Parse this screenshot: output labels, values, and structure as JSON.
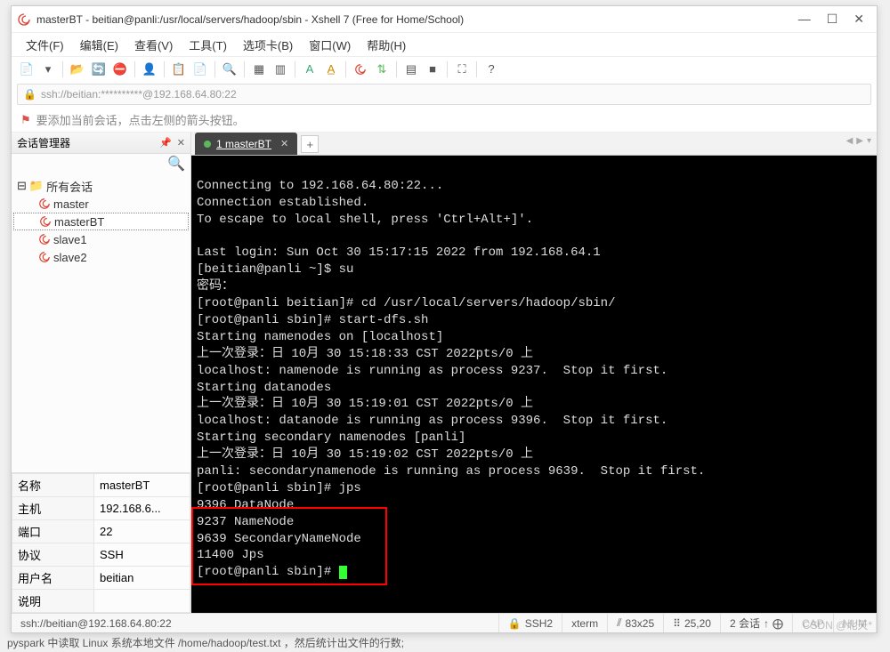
{
  "window": {
    "title": "masterBT - beitian@panli:/usr/local/servers/hadoop/sbin - Xshell 7 (Free for Home/School)"
  },
  "menubar": [
    "文件(F)",
    "编辑(E)",
    "查看(V)",
    "工具(T)",
    "选项卡(B)",
    "窗口(W)",
    "帮助(H)"
  ],
  "address": "ssh://beitian:**********@192.168.64.80:22",
  "hint": "要添加当前会话，点击左侧的箭头按钮。",
  "sidebar": {
    "title": "会话管理器",
    "root": "所有会话",
    "items": [
      "master",
      "masterBT",
      "slave1",
      "slave2"
    ],
    "selectedIndex": 1
  },
  "properties": {
    "rows": [
      {
        "k": "名称",
        "v": "masterBT"
      },
      {
        "k": "主机",
        "v": "192.168.6..."
      },
      {
        "k": "端口",
        "v": "22"
      },
      {
        "k": "协议",
        "v": "SSH"
      },
      {
        "k": "用户名",
        "v": "beitian"
      },
      {
        "k": "说明",
        "v": ""
      }
    ]
  },
  "tab": {
    "label": "1 masterBT"
  },
  "terminal_lines": [
    "",
    "Connecting to 192.168.64.80:22...",
    "Connection established.",
    "To escape to local shell, press 'Ctrl+Alt+]'.",
    "",
    "Last login: Sun Oct 30 15:17:15 2022 from 192.168.64.1",
    "[beitian@panli ~]$ su",
    "密码：",
    "[root@panli beitian]# cd /usr/local/servers/hadoop/sbin/",
    "[root@panli sbin]# start-dfs.sh",
    "Starting namenodes on [localhost]",
    "上一次登录：日 10月 30 15:18:33 CST 2022pts/0 上",
    "localhost: namenode is running as process 9237.  Stop it first.",
    "Starting datanodes",
    "上一次登录：日 10月 30 15:19:01 CST 2022pts/0 上",
    "localhost: datanode is running as process 9396.  Stop it first.",
    "Starting secondary namenodes [panli]",
    "上一次登录：日 10月 30 15:19:02 CST 2022pts/0 上",
    "panli: secondarynamenode is running as process 9639.  Stop it first.",
    "[root@panli sbin]# jps",
    "9396 DataNode",
    "9237 NameNode",
    "9639 SecondaryNameNode",
    "11400 Jps",
    "[root@panli sbin]# "
  ],
  "statusbar": {
    "conn": "ssh://beitian@192.168.64.80:22",
    "proto": "SSH2",
    "term": "xterm",
    "size": "83x25",
    "pos": "25,20",
    "sessions": "2 会话",
    "cap": "CAP",
    "num": "NUM"
  },
  "watermark": "CSDN @北天*",
  "bgline": "pyspark 中读取 Linux 系统本地文件 /home/hadoop/test.txt ，然后统计出文件的行数;"
}
